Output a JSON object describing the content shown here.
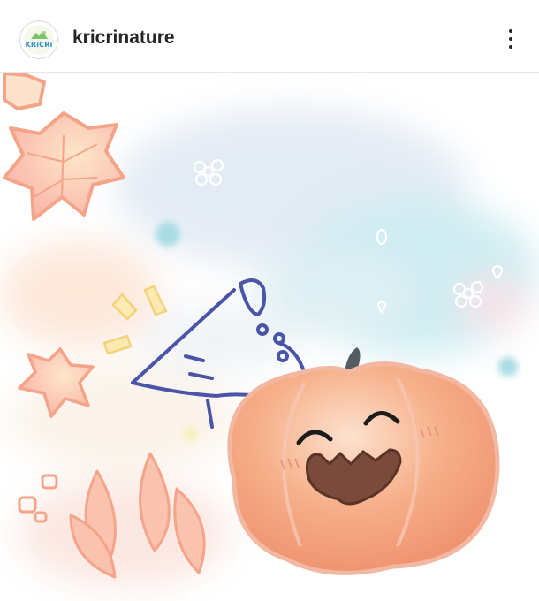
{
  "header": {
    "username": "kricrinature",
    "avatar_icon": "kricri-logo-icon",
    "avatar_text": "KRiCRi",
    "more_icon": "more-vertical-icon"
  },
  "post": {
    "image_icon": "halloween-pumpkin-illustration",
    "colors": {
      "pumpkin": "#f2a07a",
      "leaf_outline": "#f0a07e",
      "line_drawing": "#4a55a8",
      "sky_blue": "#bfe4ee"
    }
  }
}
